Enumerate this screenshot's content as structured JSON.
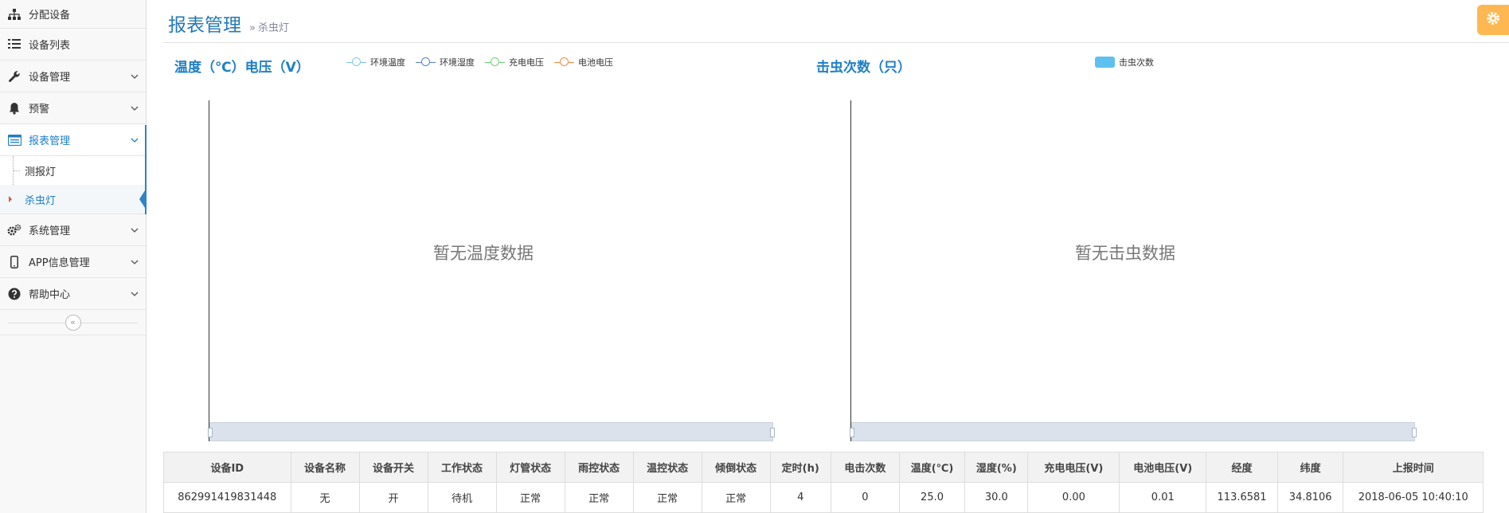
{
  "sidebar": {
    "items": [
      {
        "label": "分配设备"
      },
      {
        "label": "设备列表"
      },
      {
        "label": "设备管理"
      },
      {
        "label": "预警"
      },
      {
        "label": "报表管理"
      },
      {
        "label": "系统管理"
      },
      {
        "label": "APP信息管理"
      },
      {
        "label": "帮助中心"
      }
    ],
    "report_sub": [
      {
        "label": "测报灯"
      },
      {
        "label": "杀虫灯"
      }
    ],
    "collapse_label": "«"
  },
  "header": {
    "title": "报表管理",
    "breadcrumb_sep": "»",
    "breadcrumb_current": "杀虫灯"
  },
  "colors": {
    "accent": "#1f7fc6",
    "settings_bg": "#ffb752",
    "series": [
      "#7ec8e8",
      "#5b7fd8",
      "#6fd276",
      "#f28b46"
    ],
    "bar": "#5ec0ee"
  },
  "chart_data": [
    {
      "type": "line",
      "title": "温度（℃）电压（V）",
      "legend": {
        "placement": "top",
        "entries": [
          "环境温度",
          "环境湿度",
          "充电电压",
          "电池电压"
        ]
      },
      "series": [
        {
          "name": "环境温度",
          "values": []
        },
        {
          "name": "环境湿度",
          "values": []
        },
        {
          "name": "充电电压",
          "values": []
        },
        {
          "name": "电池电压",
          "values": []
        }
      ],
      "empty_text": "暂无温度数据"
    },
    {
      "type": "bar",
      "title": "击虫次数（只）",
      "legend": {
        "placement": "top",
        "entries": [
          "击虫次数"
        ]
      },
      "series": [
        {
          "name": "击虫次数",
          "values": []
        }
      ],
      "empty_text": "暂无击虫数据"
    }
  ],
  "table": {
    "headers": [
      "设备ID",
      "设备名称",
      "设备开关",
      "工作状态",
      "灯管状态",
      "雨控状态",
      "温控状态",
      "倾倒状态",
      "定时(h)",
      "电击次数",
      "温度(℃)",
      "湿度(%)",
      "充电电压(V)",
      "电池电压(V)",
      "经度",
      "纬度",
      "上报时间"
    ],
    "rows": [
      [
        "862991419831448",
        "无",
        "开",
        "待机",
        "正常",
        "正常",
        "正常",
        "正常",
        "4",
        "0",
        "25.0",
        "30.0",
        "0.00",
        "0.01",
        "113.6581",
        "34.8106",
        "2018-06-05 10:40:10"
      ]
    ]
  }
}
